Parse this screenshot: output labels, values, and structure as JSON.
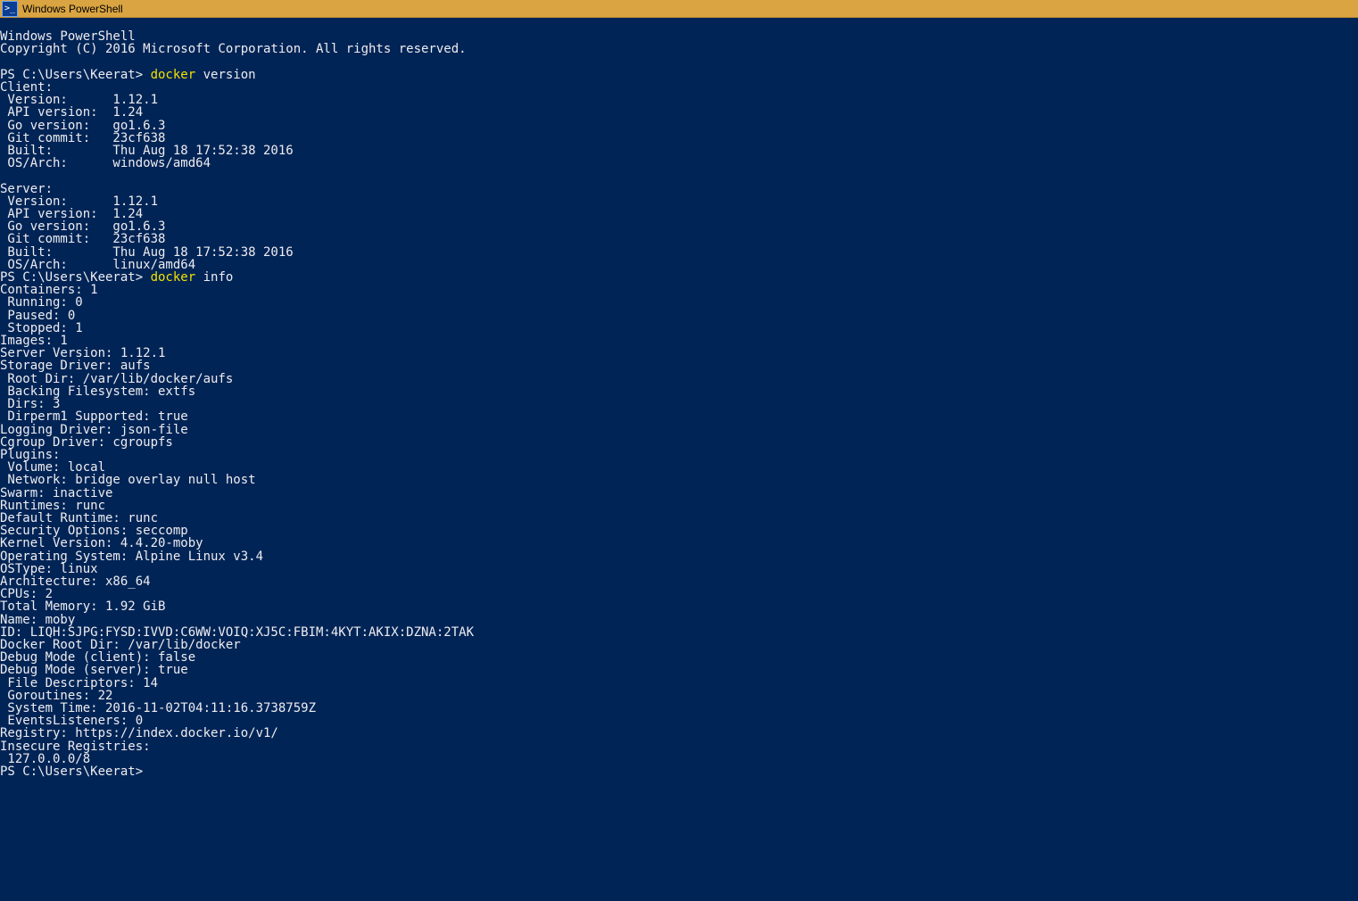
{
  "window": {
    "title": "Windows PowerShell",
    "icon_glyph": ">_"
  },
  "term": {
    "header1": "Windows PowerShell",
    "header2": "Copyright (C) 2016 Microsoft Corporation. All rights reserved.",
    "prompt": "PS C:\\Users\\Keerat> ",
    "cmd1": "docker",
    "cmd1_args": " version",
    "cmd2": "docker",
    "cmd2_args": " info",
    "client_label": "Client:",
    "cl_version": " Version:      1.12.1",
    "cl_api": " API version:  1.24",
    "cl_go": " Go version:   go1.6.3",
    "cl_git": " Git commit:   23cf638",
    "cl_built": " Built:        Thu Aug 18 17:52:38 2016",
    "cl_os": " OS/Arch:      windows/amd64",
    "server_label": "Server:",
    "sv_version": " Version:      1.12.1",
    "sv_api": " API version:  1.24",
    "sv_go": " Go version:   go1.6.3",
    "sv_git": " Git commit:   23cf638",
    "sv_built": " Built:        Thu Aug 18 17:52:38 2016",
    "sv_os": " OS/Arch:      linux/amd64",
    "info01": "Containers: 1",
    "info02": " Running: 0",
    "info03": " Paused: 0",
    "info04": " Stopped: 1",
    "info05": "Images: 1",
    "info06": "Server Version: 1.12.1",
    "info07": "Storage Driver: aufs",
    "info08": " Root Dir: /var/lib/docker/aufs",
    "info09": " Backing Filesystem: extfs",
    "info10": " Dirs: 3",
    "info11": " Dirperm1 Supported: true",
    "info12": "Logging Driver: json-file",
    "info13": "Cgroup Driver: cgroupfs",
    "info14": "Plugins:",
    "info15": " Volume: local",
    "info16": " Network: bridge overlay null host",
    "info17": "Swarm: inactive",
    "info18": "Runtimes: runc",
    "info19": "Default Runtime: runc",
    "info20": "Security Options: seccomp",
    "info21": "Kernel Version: 4.4.20-moby",
    "info22": "Operating System: Alpine Linux v3.4",
    "info23": "OSType: linux",
    "info24": "Architecture: x86_64",
    "info25": "CPUs: 2",
    "info26": "Total Memory: 1.92 GiB",
    "info27": "Name: moby",
    "info28": "ID: LIQH:SJPG:FYSD:IVVD:C6WW:VOIQ:XJ5C:FBIM:4KYT:AKIX:DZNA:2TAK",
    "info29": "Docker Root Dir: /var/lib/docker",
    "info30": "Debug Mode (client): false",
    "info31": "Debug Mode (server): true",
    "info32": " File Descriptors: 14",
    "info33": " Goroutines: 22",
    "info34": " System Time: 2016-11-02T04:11:16.3738759Z",
    "info35": " EventsListeners: 0",
    "info36": "Registry: https://index.docker.io/v1/",
    "info37": "Insecure Registries:",
    "info38": " 127.0.0.0/8"
  }
}
